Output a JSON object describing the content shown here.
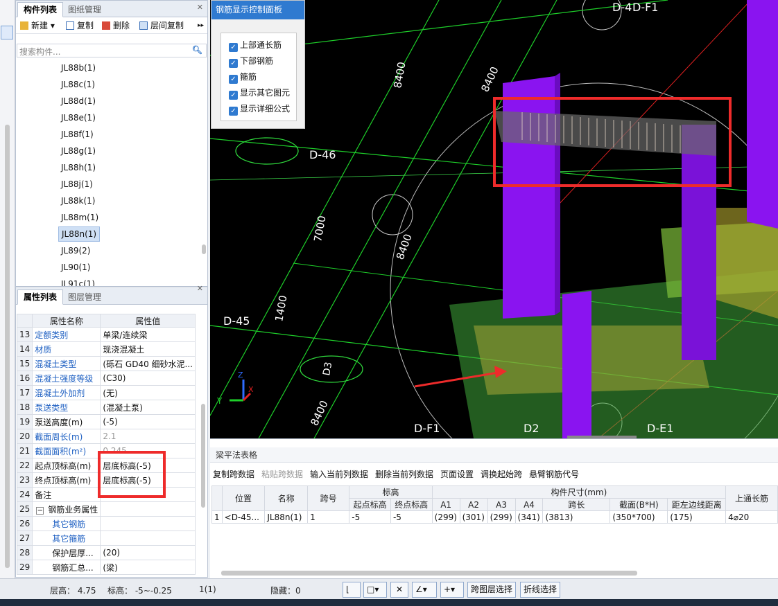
{
  "component_panel": {
    "tabs": [
      "构件列表",
      "图纸管理"
    ],
    "toolbar": {
      "new": "新建",
      "copy": "复制",
      "delete": "删除",
      "floor_copy": "层间复制",
      "more": "▸▸"
    },
    "search_placeholder": "搜索构件...",
    "items": [
      "JL88b(1)",
      "JL88c(1)",
      "JL88d(1)",
      "JL88e(1)",
      "JL88f(1)",
      "JL88g(1)",
      "JL88h(1)",
      "JL88j(1)",
      "JL88k(1)",
      "JL88m(1)",
      "JL88n(1)",
      "JL89(2)",
      "JL90(1)",
      "JL91c(1)"
    ],
    "selected_item": "JL88n(1)"
  },
  "property_panel": {
    "tabs": [
      "属性列表",
      "图层管理"
    ],
    "col_name": "属性名称",
    "col_value": "属性值",
    "rows": [
      {
        "no": "13",
        "name": "定额类别",
        "value": "单梁/连续梁"
      },
      {
        "no": "14",
        "name": "材质",
        "value": "现浇混凝土"
      },
      {
        "no": "15",
        "name": "混凝土类型",
        "value": "(砾石 GD40 细砂水泥..."
      },
      {
        "no": "16",
        "name": "混凝土强度等级",
        "value": "(C30)"
      },
      {
        "no": "17",
        "name": "混凝土外加剂",
        "value": "(无)"
      },
      {
        "no": "18",
        "name": "泵送类型",
        "value": "(混凝土泵)"
      },
      {
        "no": "19",
        "name": "泵送高度(m)",
        "value": "(-5)"
      },
      {
        "no": "20",
        "name": "截面周长(m)",
        "value": "2.1"
      },
      {
        "no": "21",
        "name": "截面面积(m²)",
        "value": "0.245"
      },
      {
        "no": "22",
        "name": "起点顶标高(m)",
        "value": "层底标高(-5)"
      },
      {
        "no": "23",
        "name": "终点顶标高(m)",
        "value": "层底标高(-5)"
      },
      {
        "no": "24",
        "name": "备注",
        "value": ""
      },
      {
        "no": "25",
        "name": "钢筋业务属性",
        "value": ""
      },
      {
        "no": "26",
        "name": "其它钢筋",
        "value": ""
      },
      {
        "no": "27",
        "name": "其它箍筋",
        "value": ""
      },
      {
        "no": "28",
        "name": "保护层厚...",
        "value": "(20)"
      },
      {
        "no": "29",
        "name": "钢筋汇总...",
        "value": "(梁)"
      }
    ],
    "group_toggle": "−"
  },
  "control_panel": {
    "title": "钢筋显示控制面板",
    "options": [
      "上部通长筋",
      "下部钢筋",
      "箍筋",
      "显示其它图元",
      "显示详细公式"
    ]
  },
  "view_labels": {
    "d4_df1": "D-4",
    "df1_top": "D-F1",
    "d46": "D-46",
    "d45": "D-45",
    "df1_bottom": "D-F1",
    "d2": "D2",
    "de1": "D-E1",
    "dim1": "8400",
    "dim2": "8400",
    "dim3": "8400",
    "dim4": "8400",
    "dim5": "7000",
    "dim6": "1400",
    "bubble1": "D3",
    "axis_z": "Z",
    "axis_y": "Y",
    "axis_x": "X"
  },
  "grid_panel": {
    "title": "梁平法表格",
    "toolbar": [
      "复制跨数据",
      "粘贴跨数据",
      "输入当前列数据",
      "删除当前列数据",
      "页面设置",
      "调换起始跨",
      "悬臂钢筋代号"
    ],
    "headers": {
      "position": "位置",
      "name": "名称",
      "span_no": "跨号",
      "elevation": "标高",
      "start_elev": "起点标高",
      "end_elev": "终点标高",
      "dims": "构件尺寸(mm)",
      "a1": "A1",
      "a2": "A2",
      "a3": "A3",
      "a4": "A4",
      "span_len": "跨长",
      "section": "截面(B*H)",
      "edge_dist": "距左边线距离",
      "top_bar": "上通长筋"
    },
    "row": {
      "no": "1",
      "position": "<D-45...",
      "name": "JL88n(1)",
      "span_no": "1",
      "start_elev": "-5",
      "end_elev": "-5",
      "a1": "(299)",
      "a2": "(301)",
      "a3": "(299)",
      "a4": "(341)",
      "span_len": "(3813)",
      "section": "(350*700)",
      "edge_dist": "(175)",
      "top_bar": "4⌀20"
    }
  },
  "status_bar": {
    "floor_height": "层高： 4.75",
    "elevation": "标高： -5~-0.25",
    "count": "1(1)",
    "hidden": "隐藏：0",
    "cross_layer": "跨图层选择",
    "polyline": "折线选择"
  }
}
